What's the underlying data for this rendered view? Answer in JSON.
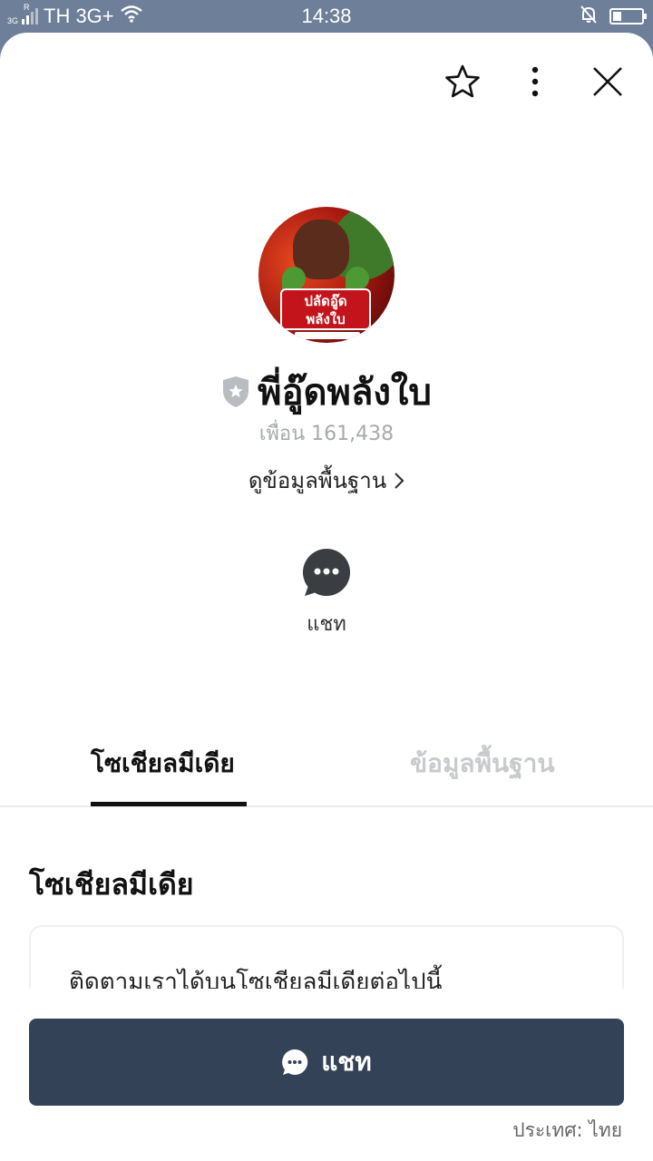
{
  "status_bar": {
    "network_small": "3G",
    "roaming": "R",
    "carrier": "TH 3G+",
    "time": "14:38",
    "battery_level": 0.3
  },
  "header_actions": {
    "favorite_icon": "star-outline-icon",
    "more_icon": "more-vertical-icon",
    "close_icon": "close-icon"
  },
  "profile": {
    "avatar_text": "ปลัดอู๊ด\nพลังใบ",
    "verified_badge_icon": "shield-star-icon",
    "name": "พี่อู๊ดพลังใบ",
    "friends": "เพื่อน 161,438",
    "basic_info_link": "ดูข้อมูลพื้นฐาน"
  },
  "actions": {
    "chat_label": "แชท"
  },
  "tabs": [
    {
      "label": "โซเชียลมีเดีย",
      "active": true
    },
    {
      "label": "ข้อมูลพื้นฐาน",
      "active": false
    }
  ],
  "social": {
    "title": "โซเชียลมีเดีย",
    "card_text": "ติดตามเราได้บนโซเชียลมีเดียต่อไปนี้"
  },
  "footer": {
    "chat_button_label": "แชท",
    "country": "ประเทศ: ไทย"
  },
  "colors": {
    "status_bar": "#6e7f99",
    "primary_button": "#344258",
    "muted_text": "#a7a9ad",
    "inactive_tab": "#c8cacd"
  }
}
